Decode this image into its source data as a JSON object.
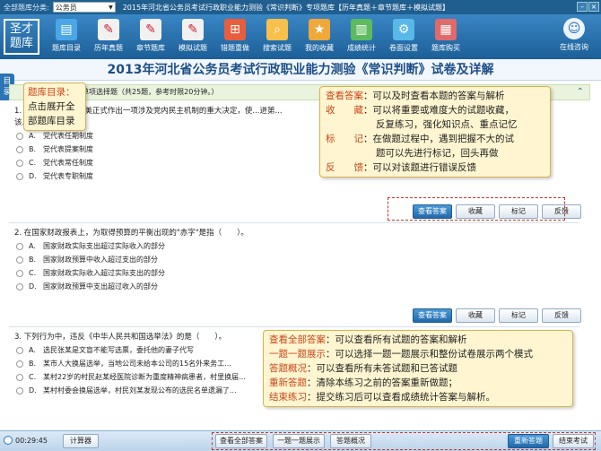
{
  "topbar": {
    "category_label": "全部题库分类:",
    "category_value": "公务员",
    "exam_title": "2015年河北省公务员考试行政职业能力测验《常识判断》专项题库【历年真题＋章节题库＋模拟试题】"
  },
  "logo": {
    "line1": "圣才",
    "line2": "题库"
  },
  "toolbar": {
    "items": [
      {
        "label": "题库目录",
        "icon": "monitor-icon",
        "glyph": "▤",
        "color": "#4aa6e6"
      },
      {
        "label": "历年真题",
        "icon": "notebook-icon",
        "glyph": "✎",
        "color": "#f1f1f1"
      },
      {
        "label": "章节题库",
        "icon": "notebook-icon",
        "glyph": "✎",
        "color": "#f1f1f1"
      },
      {
        "label": "模拟试题",
        "icon": "notebook-icon",
        "glyph": "✎",
        "color": "#f1f1f1"
      },
      {
        "label": "错题重做",
        "icon": "redo-grid-icon",
        "glyph": "⊞",
        "color": "#e85d3c"
      },
      {
        "label": "搜索试题",
        "icon": "magnifier-icon",
        "glyph": "⌕",
        "color": "#f7c04a"
      },
      {
        "label": "我的收藏",
        "icon": "folder-icon",
        "glyph": "★",
        "color": "#f0a83a"
      },
      {
        "label": "成绩统计",
        "icon": "stats-icon",
        "glyph": "▥",
        "color": "#5dbb5d"
      },
      {
        "label": "卷面设置",
        "icon": "settings-icon",
        "glyph": "⚙",
        "color": "#58b8e8"
      },
      {
        "label": "题库购买",
        "icon": "cart-icon",
        "glyph": "▦",
        "color": "#e06a6a"
      }
    ],
    "help_label": "在线咨询"
  },
  "page_title": "2013年河北省公务员考试行政职业能力测验《常识判断》试卷及详解",
  "side_tab_label": "目录",
  "section_bar": "单项选择题（共25题，参考时限20分钟。）",
  "questions": [
    {
      "number": "1",
      "text_line1": "1. 在我国...按照真善美正式作出一项涉及党内民主机制的重大决定，使...进第...",
      "text_line2": "该...最...（　）。",
      "options": [
        {
          "letter": "A.",
          "text": "党代表任期制度"
        },
        {
          "letter": "B.",
          "text": "党代表提案制度"
        },
        {
          "letter": "C.",
          "text": "党代表常任制度"
        },
        {
          "letter": "D.",
          "text": "党代表专职制度"
        }
      ]
    },
    {
      "number": "2",
      "text_line1": "2. 在国家财政报表上，为取得预算的平衡出现的\"赤字\"是指（　　）。",
      "options": [
        {
          "letter": "A.",
          "text": "国家财政实际支出超过实际收入的部分"
        },
        {
          "letter": "B.",
          "text": "国家财政预算中收入超过支出的部分"
        },
        {
          "letter": "C.",
          "text": "国家财政实际收入超过实际支出的部分"
        },
        {
          "letter": "D.",
          "text": "国家财政预算中支出超过收入的部分"
        }
      ]
    },
    {
      "number": "3",
      "text_line1": "3. 下列行为中，违反《中华人民共和国选举法》的是（　　）。",
      "options": [
        {
          "letter": "A.",
          "text": "选民张某是文盲不能写选票，委托他的妻子代写"
        },
        {
          "letter": "B.",
          "text": "某市人大换届选举，当地公司未给本公司的15名外来务工..."
        },
        {
          "letter": "C.",
          "text": "某村22岁的村民赵某经医院诊断为重度精神病患者，村里换届..."
        },
        {
          "letter": "D.",
          "text": "某村村委会换届选举，村民刘某发现公布的选民名单遗漏了..."
        }
      ]
    }
  ],
  "question_buttons": {
    "answer": "查看答案",
    "collect": "收藏",
    "mark": "标记",
    "feedback": "反馈"
  },
  "callout_catalog": {
    "line1": "题库目录：",
    "line2": "点击展开全",
    "line3": "部题库目录"
  },
  "callout_answer": {
    "rows": [
      {
        "key": "查看答案",
        "text": "：可以及时查看本题的答案与解析"
      },
      {
        "key": "收　　藏",
        "text": "：可以将重要或难度大的试题收藏，"
      },
      {
        "key": "",
        "text": "反复练习，强化知识点、重点记忆"
      },
      {
        "key": "标　　记",
        "text": "：在做题过程中，遇到把握不大的试"
      },
      {
        "key": "",
        "text": "题可以先进行标记，回头再做"
      },
      {
        "key": "反　　馈",
        "text": "：可以对该题进行错误反馈"
      }
    ]
  },
  "callout_bottom": {
    "rows": [
      {
        "key": "查看全部答案",
        "text": "：可以查看所有试题的答案和解析"
      },
      {
        "key": "一题一题展示",
        "text": "：可以选择一题一题展示和整份试卷展示两个模式"
      },
      {
        "key": "答题概况",
        "text": "：可以查看所有未答试题和已答试题"
      },
      {
        "key": "重新答题",
        "text": "：清除本练习之前的答案重新做题；"
      },
      {
        "key": "结束练习",
        "text": "：提交练习后可以查看成绩统计答案与解析。"
      }
    ]
  },
  "statusbar": {
    "time": "00:29:45",
    "calculator": "计算器",
    "show_all": "查看全部答案",
    "one_by_one": "一题一题展示",
    "overview": "答题概况",
    "restart": "重新答题",
    "finish": "结束考试"
  }
}
